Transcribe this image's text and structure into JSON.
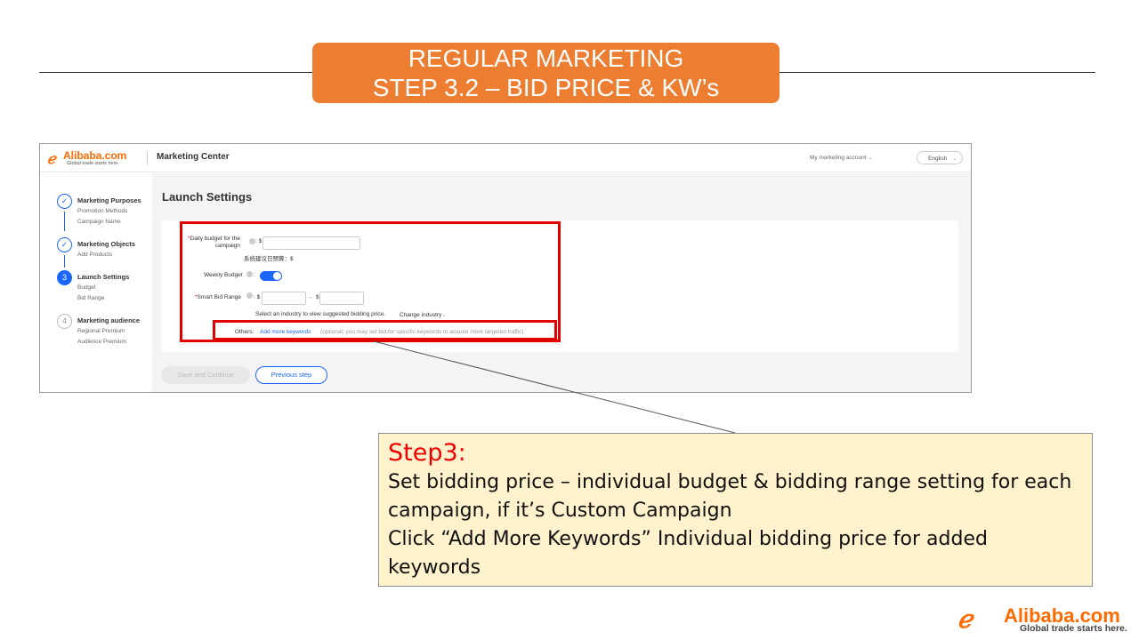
{
  "slide": {
    "banner_line1": "REGULAR MARKETING",
    "banner_line2": "STEP 3.2 – BID PRICE & KW’s"
  },
  "app": {
    "logo_brand": "Alibaba.com",
    "logo_tagline": "Global trade starts here.",
    "title": "Marketing Center",
    "account_menu": "My marketing account",
    "language": "English"
  },
  "sidebar": {
    "steps": [
      {
        "number": "✓",
        "title": "Marketing Purposes",
        "subs": [
          "Promotion Methods",
          "Campaign Name"
        ],
        "state": "done"
      },
      {
        "number": "✓",
        "title": "Marketing Objects",
        "subs": [
          "Add Products"
        ],
        "state": "done"
      },
      {
        "number": "3",
        "title": "Launch Settings",
        "subs": [
          "Budget",
          "Bid Range"
        ],
        "state": "active"
      },
      {
        "number": "4",
        "title": "Marketing audience",
        "subs": [
          "Regional Premium",
          "Audience Premium"
        ],
        "state": "todo"
      }
    ]
  },
  "form": {
    "page_title": "Launch Settings",
    "daily_budget_label_1": "Daily budget for the",
    "daily_budget_label_2": "campaign",
    "required_mark": "*",
    "currency": "$",
    "colon": ":",
    "daily_budget_value": "",
    "suggested_budget": "系统建议日预算：$",
    "weekly_budget_label": "Weekly Budget",
    "weekly_budget_on": true,
    "smart_bid_label": "Smart Bid Range",
    "range_sep": "-",
    "industry_hint": "Select an industry to view suggested bidding price.",
    "change_industry": "Change industry",
    "others_label": "Others:",
    "add_keywords_link": "Add more keywords",
    "add_keywords_hint": "(optional; you may set bid for specific keywords to acquire more targeted traffic)"
  },
  "buttons": {
    "save": "Save and Continue",
    "previous": "Previous step"
  },
  "callout": {
    "title": "Step3:",
    "line1": "Set bidding price – individual budget & bidding range setting for each campaign, if it’s Custom Campaign",
    "line2": "Click “Add More Keywords” Individual bidding price for added keywords"
  },
  "colors": {
    "banner": "#ed7d31",
    "highlight": "#e10000",
    "accent": "#1a66ff",
    "callout_bg": "#fff2cc",
    "alibaba_orange": "#ff6a00"
  }
}
